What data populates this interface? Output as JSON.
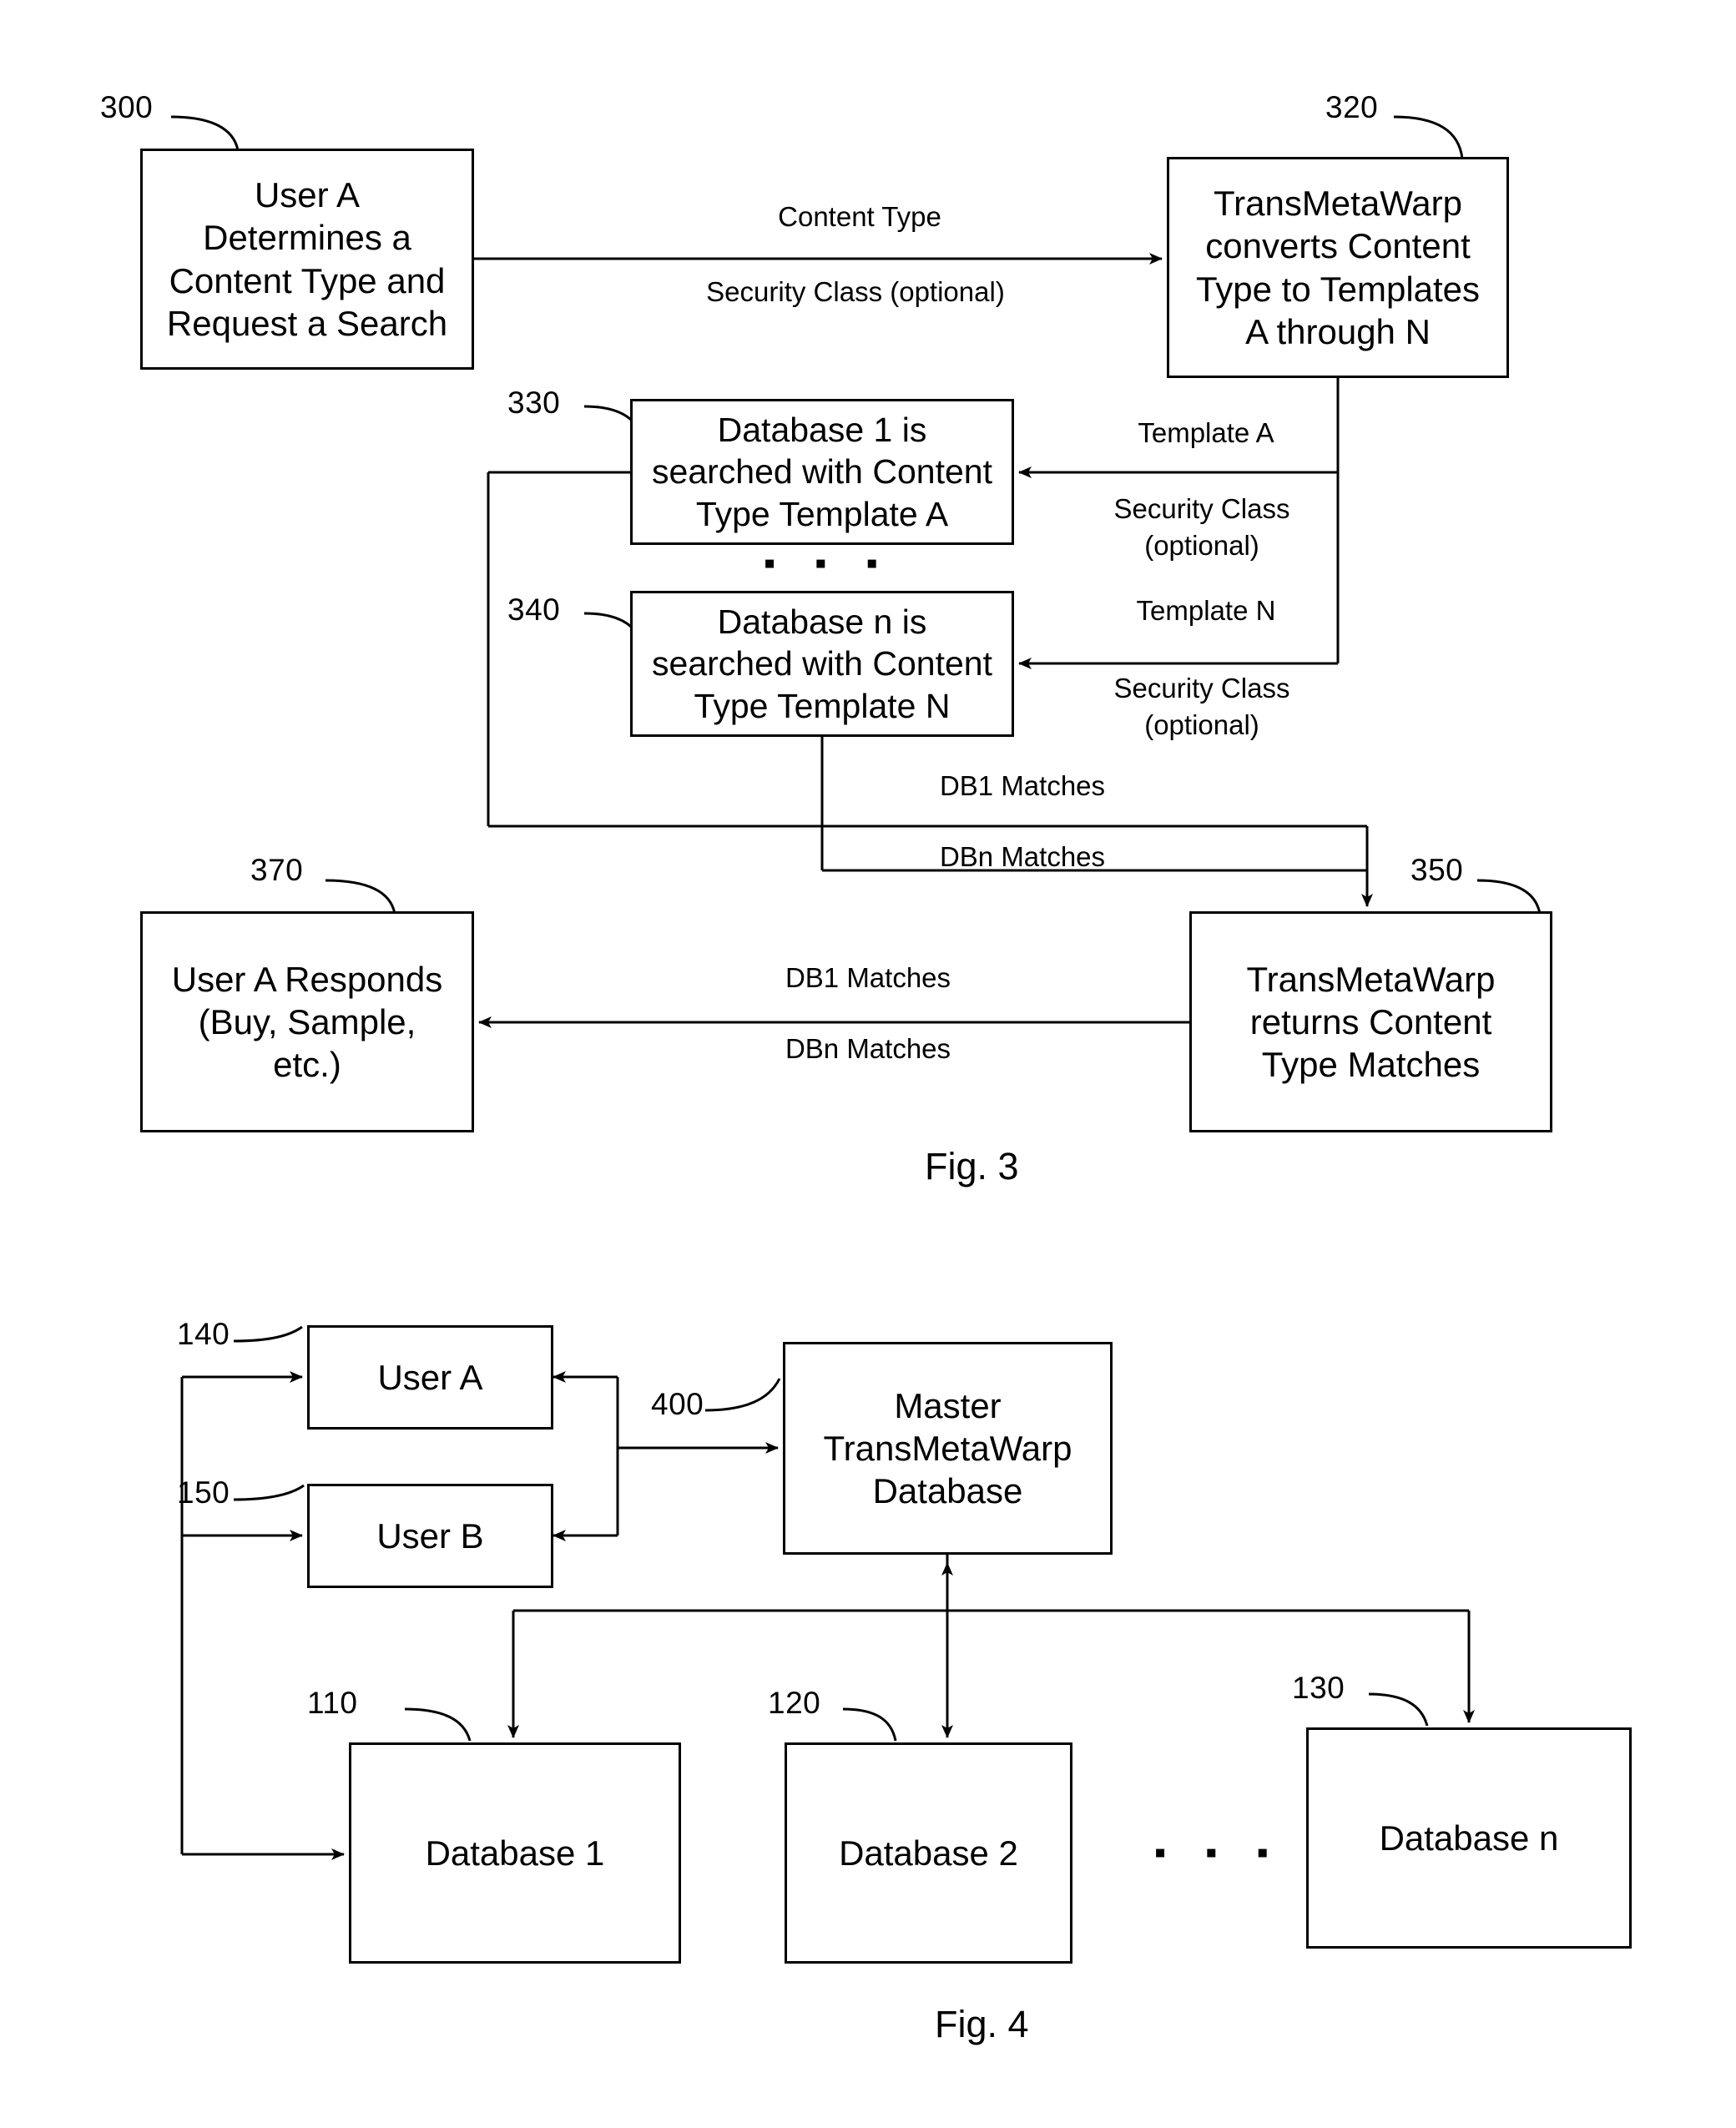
{
  "document": {
    "type": "patent-drawing-sheet",
    "figures": [
      {
        "caption": "Fig. 3",
        "nodes": [
          {
            "ref": "300",
            "text": "User A\nDetermines a\nContent Type and\nRequest a Search"
          },
          {
            "ref": "320",
            "text": "TransMetaWarp\nconverts Content\nType to Templates\nA through N"
          },
          {
            "ref": "330",
            "text": "Database 1 is\nsearched with Content\nType Template A"
          },
          {
            "ref": "340",
            "text": "Database n is\nsearched with Content\nType Template N"
          },
          {
            "ref": "350",
            "text": "TransMetaWarp\nreturns Content\nType Matches"
          },
          {
            "ref": "370",
            "text": "User A Responds\n(Buy, Sample,\netc.)"
          }
        ],
        "edge_labels": [
          {
            "id": "content-type",
            "text": "Content Type"
          },
          {
            "id": "security-class-1",
            "text": "Security Class (optional)"
          },
          {
            "id": "template-a",
            "text": "Template A"
          },
          {
            "id": "security-class-2",
            "text": "Security Class\n(optional)"
          },
          {
            "id": "template-n",
            "text": "Template N"
          },
          {
            "id": "security-class-3",
            "text": "Security Class\n(optional)"
          },
          {
            "id": "db1-matches-up",
            "text": "DB1 Matches"
          },
          {
            "id": "dbn-matches-up",
            "text": "DBn Matches"
          },
          {
            "id": "db1-matches-out",
            "text": "DB1 Matches"
          },
          {
            "id": "dbn-matches-out",
            "text": "DBn Matches"
          }
        ],
        "ellipsis": "▪  ▪  ▪"
      },
      {
        "caption": "Fig. 4",
        "nodes": [
          {
            "ref": "140",
            "text": "User A"
          },
          {
            "ref": "150",
            "text": "User B"
          },
          {
            "ref": "400",
            "text": "Master\nTransMetaWarp\nDatabase"
          },
          {
            "ref": "110",
            "text": "Database 1"
          },
          {
            "ref": "120",
            "text": "Database 2"
          },
          {
            "ref": "130",
            "text": "Database n"
          }
        ],
        "ellipsis": "▪  ▪  ▪"
      }
    ]
  },
  "colors": {
    "ink": "#000000",
    "paper": "#ffffff"
  }
}
